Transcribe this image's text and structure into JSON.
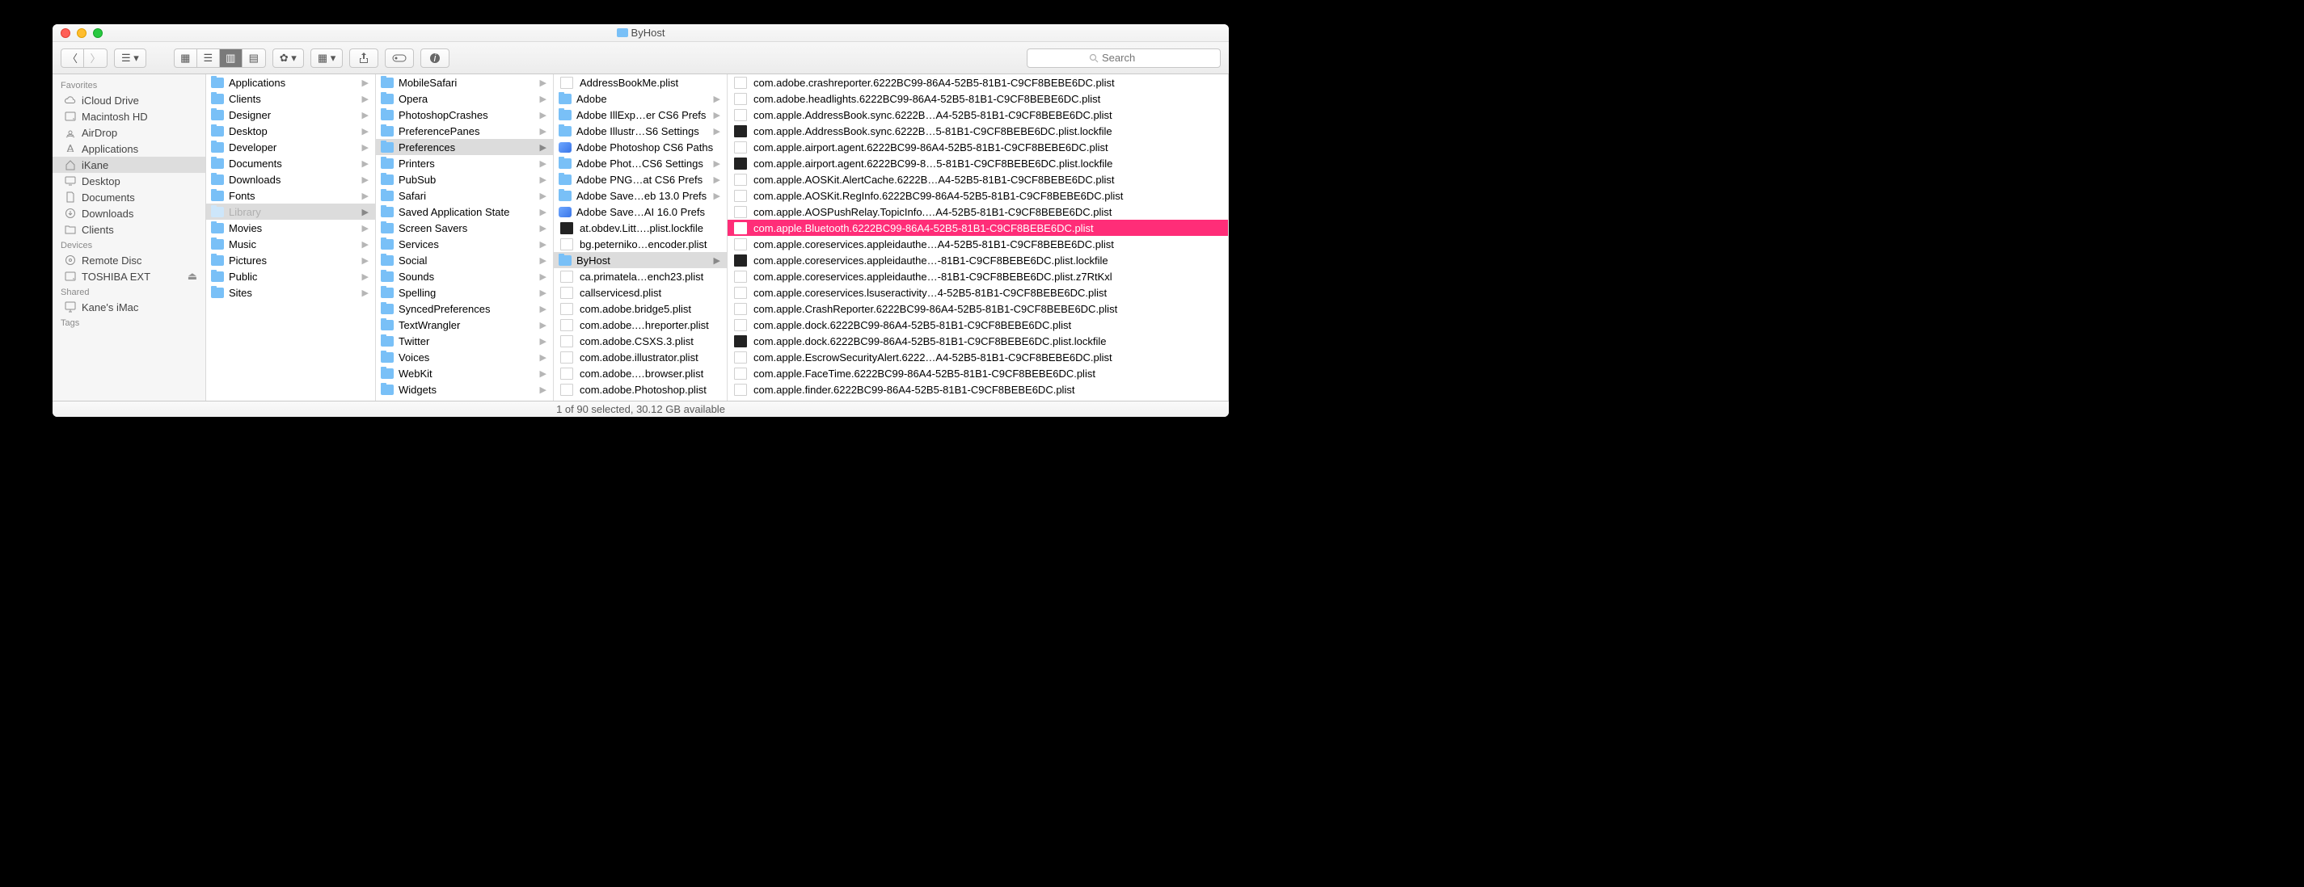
{
  "window": {
    "title": "ByHost"
  },
  "toolbar": {
    "search_placeholder": "Search"
  },
  "status_bar": "1 of 90 selected, 30.12 GB available",
  "sidebar": {
    "sections": [
      {
        "label": "Favorites",
        "items": [
          {
            "icon": "cloud",
            "label": "iCloud Drive"
          },
          {
            "icon": "hdd",
            "label": "Macintosh HD"
          },
          {
            "icon": "airdrop",
            "label": "AirDrop"
          },
          {
            "icon": "apps",
            "label": "Applications"
          },
          {
            "icon": "home",
            "label": "iKane",
            "selected": true
          },
          {
            "icon": "desktop",
            "label": "Desktop"
          },
          {
            "icon": "docs",
            "label": "Documents"
          },
          {
            "icon": "downloads",
            "label": "Downloads"
          },
          {
            "icon": "folder",
            "label": "Clients"
          }
        ]
      },
      {
        "label": "Devices",
        "items": [
          {
            "icon": "disc",
            "label": "Remote Disc"
          },
          {
            "icon": "hdd",
            "label": "TOSHIBA EXT",
            "eject": true
          }
        ]
      },
      {
        "label": "Shared",
        "items": [
          {
            "icon": "imac",
            "label": "Kane's iMac"
          }
        ]
      },
      {
        "label": "Tags",
        "items": []
      }
    ]
  },
  "columns": [
    {
      "items": [
        {
          "type": "folder",
          "name": "Applications",
          "arrow": true
        },
        {
          "type": "folder",
          "name": "Clients",
          "arrow": true
        },
        {
          "type": "folder",
          "name": "Designer",
          "arrow": true
        },
        {
          "type": "folder",
          "name": "Desktop",
          "arrow": true
        },
        {
          "type": "folder",
          "name": "Developer",
          "arrow": true
        },
        {
          "type": "folder",
          "name": "Documents",
          "arrow": true
        },
        {
          "type": "folder",
          "name": "Downloads",
          "arrow": true
        },
        {
          "type": "folder",
          "name": "Fonts",
          "arrow": true
        },
        {
          "type": "folder",
          "name": "Library",
          "arrow": true,
          "dim": true,
          "path": true
        },
        {
          "type": "folder",
          "name": "Movies",
          "arrow": true
        },
        {
          "type": "folder",
          "name": "Music",
          "arrow": true
        },
        {
          "type": "folder",
          "name": "Pictures",
          "arrow": true
        },
        {
          "type": "folder",
          "name": "Public",
          "arrow": true
        },
        {
          "type": "folder",
          "name": "Sites",
          "arrow": true
        }
      ]
    },
    {
      "items": [
        {
          "type": "folder",
          "name": "MobileSafari",
          "arrow": true
        },
        {
          "type": "folder",
          "name": "Opera",
          "arrow": true
        },
        {
          "type": "folder",
          "name": "PhotoshopCrashes",
          "arrow": true
        },
        {
          "type": "folder",
          "name": "PreferencePanes",
          "arrow": true
        },
        {
          "type": "folder",
          "name": "Preferences",
          "arrow": true,
          "path": true
        },
        {
          "type": "folder",
          "name": "Printers",
          "arrow": true
        },
        {
          "type": "folder",
          "name": "PubSub",
          "arrow": true
        },
        {
          "type": "folder",
          "name": "Safari",
          "arrow": true
        },
        {
          "type": "folder",
          "name": "Saved Application State",
          "arrow": true
        },
        {
          "type": "folder",
          "name": "Screen Savers",
          "arrow": true
        },
        {
          "type": "folder",
          "name": "Services",
          "arrow": true
        },
        {
          "type": "folder",
          "name": "Social",
          "arrow": true
        },
        {
          "type": "folder",
          "name": "Sounds",
          "arrow": true
        },
        {
          "type": "folder",
          "name": "Spelling",
          "arrow": true
        },
        {
          "type": "folder",
          "name": "SyncedPreferences",
          "arrow": true
        },
        {
          "type": "folder",
          "name": "TextWrangler",
          "arrow": true
        },
        {
          "type": "folder",
          "name": "Twitter",
          "arrow": true
        },
        {
          "type": "folder",
          "name": "Voices",
          "arrow": true
        },
        {
          "type": "folder",
          "name": "WebKit",
          "arrow": true
        },
        {
          "type": "folder",
          "name": "Widgets",
          "arrow": true
        }
      ]
    },
    {
      "items": [
        {
          "type": "file",
          "name": "AddressBookMe.plist"
        },
        {
          "type": "folder",
          "name": "Adobe",
          "arrow": true
        },
        {
          "type": "folder",
          "name": "Adobe IllExp…er CS6 Prefs",
          "arrow": true
        },
        {
          "type": "folder",
          "name": "Adobe Illustr…S6 Settings",
          "arrow": true
        },
        {
          "type": "app",
          "name": "Adobe Photoshop CS6 Paths"
        },
        {
          "type": "folder",
          "name": "Adobe Phot…CS6 Settings",
          "arrow": true
        },
        {
          "type": "folder",
          "name": "Adobe PNG…at CS6 Prefs",
          "arrow": true
        },
        {
          "type": "folder",
          "name": "Adobe Save…eb 13.0 Prefs",
          "arrow": true
        },
        {
          "type": "app",
          "name": "Adobe Save…AI 16.0 Prefs"
        },
        {
          "type": "blk",
          "name": "at.obdev.Litt….plist.lockfile"
        },
        {
          "type": "file",
          "name": "bg.peterniko…encoder.plist"
        },
        {
          "type": "folder",
          "name": "ByHost",
          "arrow": true,
          "path": true
        },
        {
          "type": "file",
          "name": "ca.primatela…ench23.plist"
        },
        {
          "type": "file",
          "name": "callservicesd.plist"
        },
        {
          "type": "file",
          "name": "com.adobe.bridge5.plist"
        },
        {
          "type": "file",
          "name": "com.adobe.…hreporter.plist"
        },
        {
          "type": "file",
          "name": "com.adobe.CSXS.3.plist"
        },
        {
          "type": "file",
          "name": "com.adobe.illustrator.plist"
        },
        {
          "type": "file",
          "name": "com.adobe.…browser.plist"
        },
        {
          "type": "file",
          "name": "com.adobe.Photoshop.plist"
        }
      ]
    },
    {
      "items": [
        {
          "type": "file",
          "name": "com.adobe.crashreporter.6222BC99-86A4-52B5-81B1-C9CF8BEBE6DC.plist"
        },
        {
          "type": "file",
          "name": "com.adobe.headlights.6222BC99-86A4-52B5-81B1-C9CF8BEBE6DC.plist"
        },
        {
          "type": "file",
          "name": "com.apple.AddressBook.sync.6222B…A4-52B5-81B1-C9CF8BEBE6DC.plist"
        },
        {
          "type": "blk",
          "name": "com.apple.AddressBook.sync.6222B…5-81B1-C9CF8BEBE6DC.plist.lockfile"
        },
        {
          "type": "file",
          "name": "com.apple.airport.agent.6222BC99-86A4-52B5-81B1-C9CF8BEBE6DC.plist"
        },
        {
          "type": "blk",
          "name": "com.apple.airport.agent.6222BC99-8…5-81B1-C9CF8BEBE6DC.plist.lockfile"
        },
        {
          "type": "file",
          "name": "com.apple.AOSKit.AlertCache.6222B…A4-52B5-81B1-C9CF8BEBE6DC.plist"
        },
        {
          "type": "file",
          "name": "com.apple.AOSKit.RegInfo.6222BC99-86A4-52B5-81B1-C9CF8BEBE6DC.plist"
        },
        {
          "type": "file",
          "name": "com.apple.AOSPushRelay.TopicInfo.…A4-52B5-81B1-C9CF8BEBE6DC.plist"
        },
        {
          "type": "file",
          "name": "com.apple.Bluetooth.6222BC99-86A4-52B5-81B1-C9CF8BEBE6DC.plist",
          "selected": true
        },
        {
          "type": "file",
          "name": "com.apple.coreservices.appleidauthe…A4-52B5-81B1-C9CF8BEBE6DC.plist"
        },
        {
          "type": "blk",
          "name": "com.apple.coreservices.appleidauthe…-81B1-C9CF8BEBE6DC.plist.lockfile"
        },
        {
          "type": "file",
          "name": "com.apple.coreservices.appleidauthe…-81B1-C9CF8BEBE6DC.plist.z7RtKxl"
        },
        {
          "type": "file",
          "name": "com.apple.coreservices.lsuseractivity…4-52B5-81B1-C9CF8BEBE6DC.plist"
        },
        {
          "type": "file",
          "name": "com.apple.CrashReporter.6222BC99-86A4-52B5-81B1-C9CF8BEBE6DC.plist"
        },
        {
          "type": "file",
          "name": "com.apple.dock.6222BC99-86A4-52B5-81B1-C9CF8BEBE6DC.plist"
        },
        {
          "type": "blk",
          "name": "com.apple.dock.6222BC99-86A4-52B5-81B1-C9CF8BEBE6DC.plist.lockfile"
        },
        {
          "type": "file",
          "name": "com.apple.EscrowSecurityAlert.6222…A4-52B5-81B1-C9CF8BEBE6DC.plist"
        },
        {
          "type": "file",
          "name": "com.apple.FaceTime.6222BC99-86A4-52B5-81B1-C9CF8BEBE6DC.plist"
        },
        {
          "type": "file",
          "name": "com.apple.finder.6222BC99-86A4-52B5-81B1-C9CF8BEBE6DC.plist"
        }
      ]
    }
  ]
}
